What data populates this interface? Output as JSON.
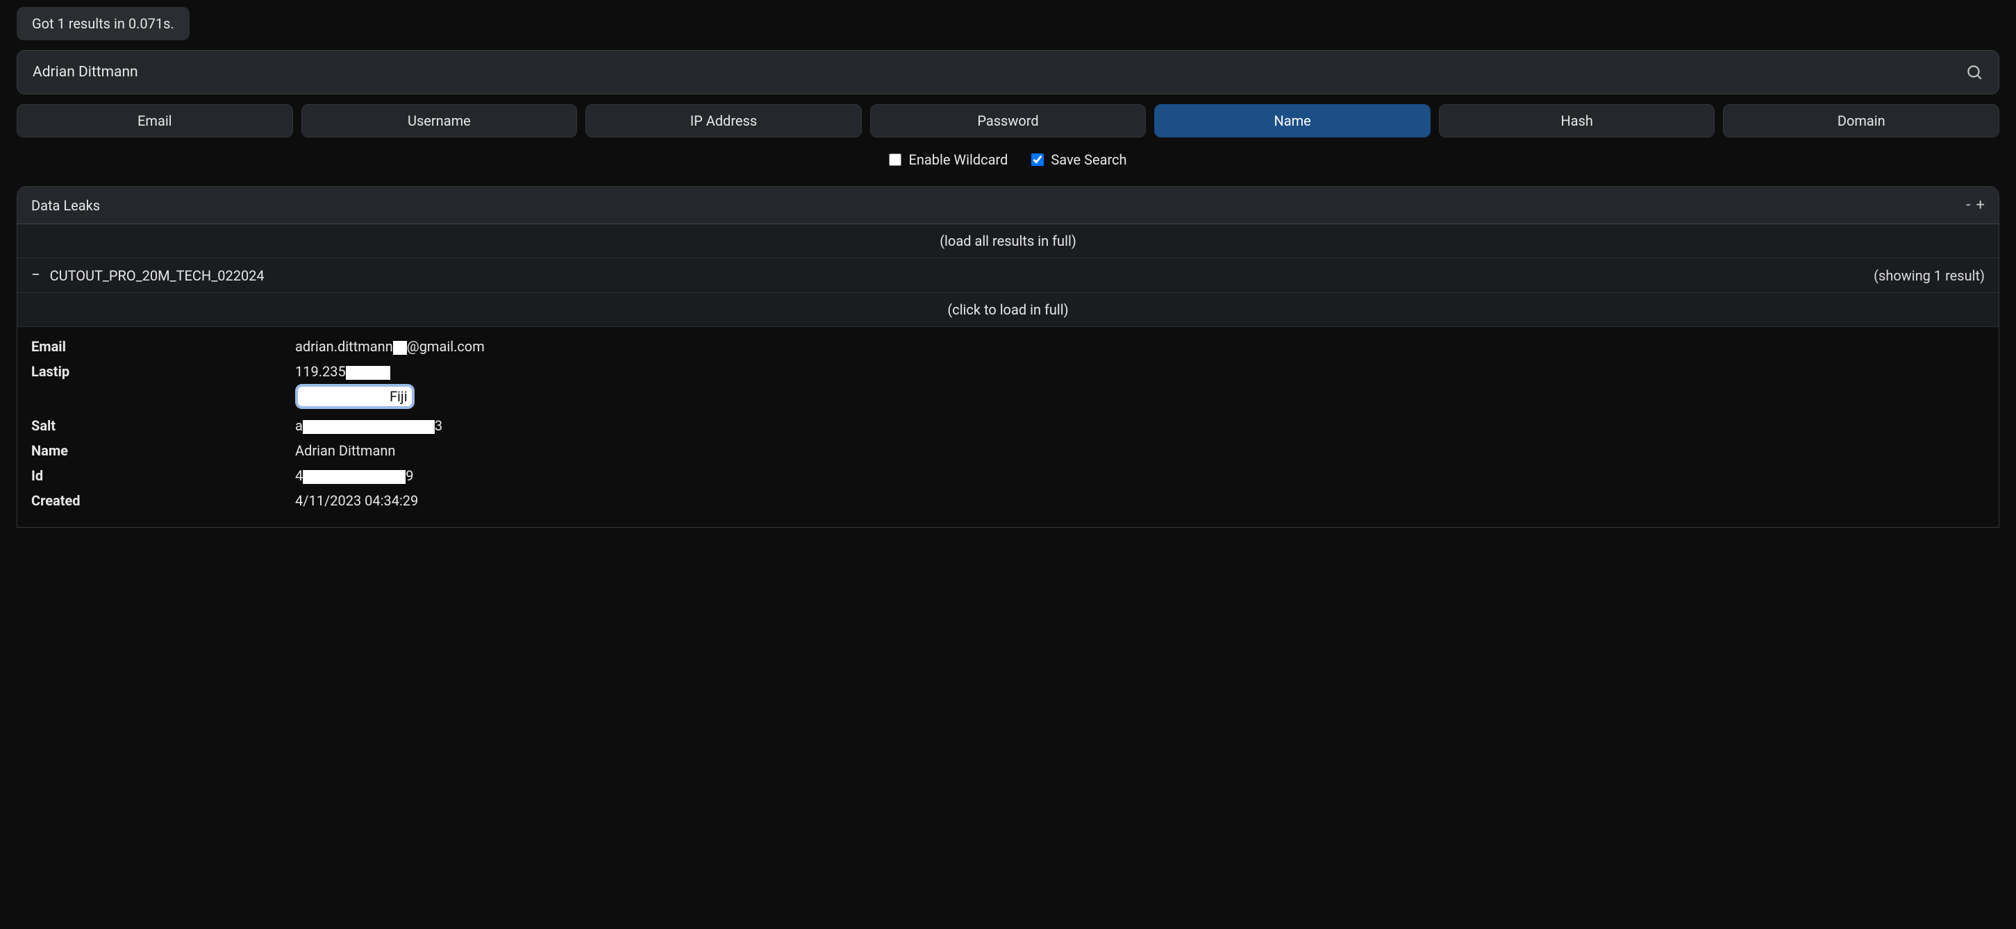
{
  "status": "Got 1 results in 0.071s.",
  "search": {
    "value": "Adrian Dittmann",
    "placeholder": ""
  },
  "tabs": [
    {
      "id": "email",
      "label": "Email",
      "active": false
    },
    {
      "id": "username",
      "label": "Username",
      "active": false
    },
    {
      "id": "ip",
      "label": "IP Address",
      "active": false
    },
    {
      "id": "password",
      "label": "Password",
      "active": false
    },
    {
      "id": "name",
      "label": "Name",
      "active": true
    },
    {
      "id": "hash",
      "label": "Hash",
      "active": false
    },
    {
      "id": "domain",
      "label": "Domain",
      "active": false
    }
  ],
  "options": {
    "enable_wildcard": {
      "label": "Enable Wildcard",
      "checked": false
    },
    "save_search": {
      "label": "Save Search",
      "checked": true
    }
  },
  "panel": {
    "title": "Data Leaks",
    "collapse": "-",
    "expand": "+",
    "load_all": "(load all results in full)",
    "dataset": {
      "toggle": "−",
      "name": "CUTOUT_PRO_20M_TECH_022024",
      "showing": "(showing 1 result)"
    },
    "click_load": "(click to load in full)",
    "record": {
      "email": {
        "key": "Email",
        "prefix": "adrian.dittmann",
        "suffix": "@gmail.com"
      },
      "lastip": {
        "key": "Lastip",
        "prefix": "119.235",
        "tag_suffix": "Fiji"
      },
      "salt": {
        "key": "Salt",
        "prefix": "a",
        "suffix": "3"
      },
      "name": {
        "key": "Name",
        "value": "Adrian Dittmann"
      },
      "id": {
        "key": "Id",
        "prefix": "4",
        "suffix": "9"
      },
      "created": {
        "key": "Created",
        "value": "4/11/2023 04:34:29"
      }
    }
  }
}
